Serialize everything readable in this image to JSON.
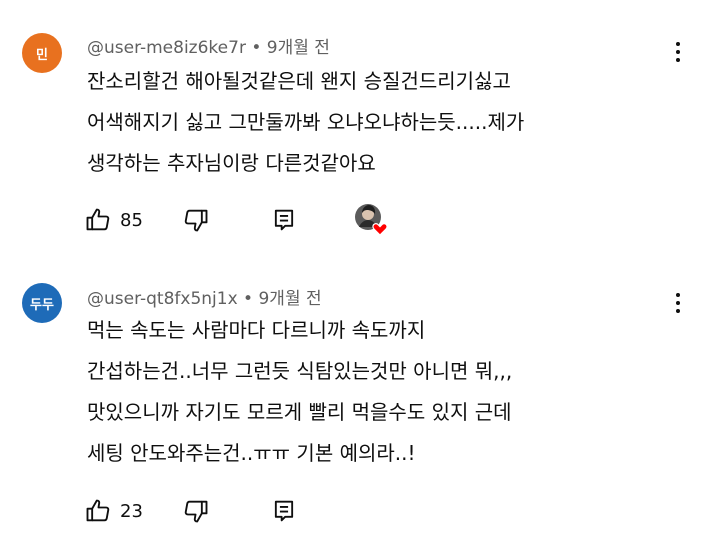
{
  "comments": [
    {
      "avatar_text": "민",
      "avatar_color": "#e8711f",
      "author": "@user-me8iz6ke7r",
      "time": "9개월 전",
      "lines": [
        "잔소리할건 해아될것같은데 왠지 승질건드리기싫고",
        "어색해지기 싫고 그만둘까봐 오냐오냐하는듯.....제가",
        "생각하는 추자님이랑 다른것같아요"
      ],
      "like_count": "85",
      "has_creator_heart": true
    },
    {
      "avatar_text": "두두",
      "avatar_color": "#1e6bb8",
      "author": "@user-qt8fx5nj1x",
      "time": "9개월 전",
      "lines": [
        "먹는 속도는 사람마다 다르니까 속도까지",
        "간섭하는건..너무 그런듯 식탐있는것만 아니면 뭐,,,",
        "맛있으니까 자기도 모르게 빨리 먹을수도 있지 근데",
        "세팅 안도와주는건..ㅠㅠ 기본 예의라..!"
      ],
      "like_count": "23",
      "has_creator_heart": false
    }
  ],
  "meta_separator": " • ",
  "icons": {
    "like": "thumb-up-icon",
    "dislike": "thumb-down-icon",
    "reply": "reply-icon",
    "more": "more-vert-icon",
    "heart": "creator-heart-icon"
  }
}
